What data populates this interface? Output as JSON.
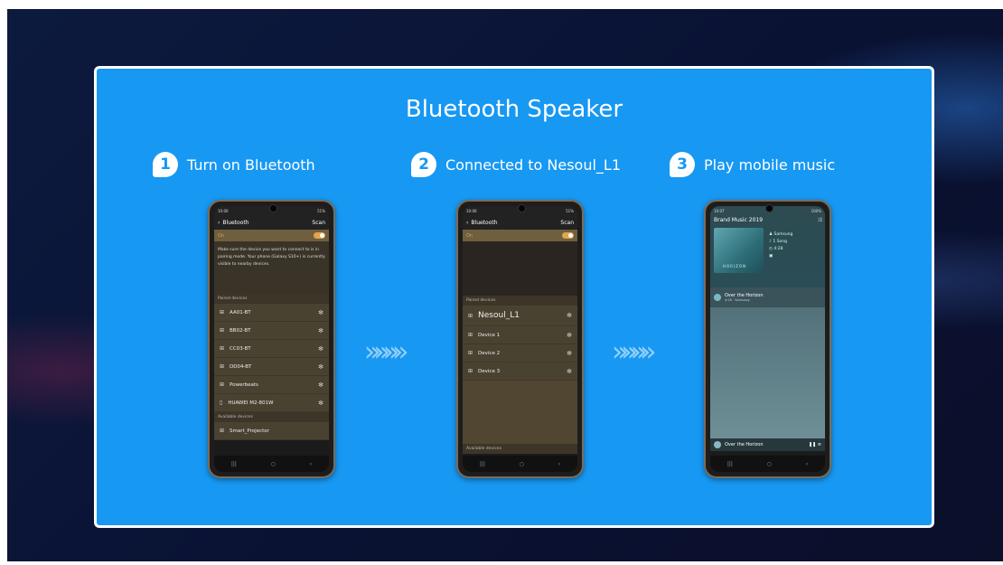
{
  "title": "Bluetooth Speaker",
  "steps": [
    {
      "number": "1",
      "label": "Turn on Bluetooth"
    },
    {
      "number": "2",
      "label": "Connected to  Nesoul_L1"
    },
    {
      "number": "3",
      "label": "Play mobile music"
    }
  ],
  "arrow_glyph": "»»»»",
  "phone1": {
    "status_left": "10:00",
    "status_right": "51%",
    "header_title": "Bluetooth",
    "header_action": "Scan",
    "toggle_label": "On",
    "description": "Make sure the device you want to connect to is in pairing mode. Your phone (Galaxy S10+) is currently visible to nearby devices.",
    "paired_label": "Paired devices",
    "paired": [
      "AA01-BT",
      "BB02-BT",
      "CC03-BT",
      "DD04-BT",
      "Powerbeats",
      "HUAWEI M2-801W"
    ],
    "available_label": "Available devices",
    "available": [
      "Smart_Projector"
    ]
  },
  "phone2": {
    "status_left": "10:00",
    "status_right": "51%",
    "header_title": "Bluetooth",
    "header_action": "Scan",
    "toggle_label": "On",
    "paired_label": "Paired devices",
    "connected_device": "Nesoul_L1",
    "devices": [
      "Device 1",
      "Device 2",
      "Device 3"
    ],
    "available_label": "Available devices"
  },
  "phone3": {
    "status_left": "10:07",
    "status_right": "100%",
    "album_title": "Brand Music 2019",
    "album_art_text": "HORIZON",
    "artist": "Samsung",
    "songs": "1 Song",
    "duration": "4:28",
    "track_title": "Over the Horizon",
    "track_meta": "4:28 · Samsung",
    "mini_player_title": "Over the Horizon"
  },
  "navbar": {
    "recent": "|||",
    "home": "○",
    "back": "‹"
  },
  "colors": {
    "panel": "#1798f2",
    "accent": "#e0a54b"
  }
}
